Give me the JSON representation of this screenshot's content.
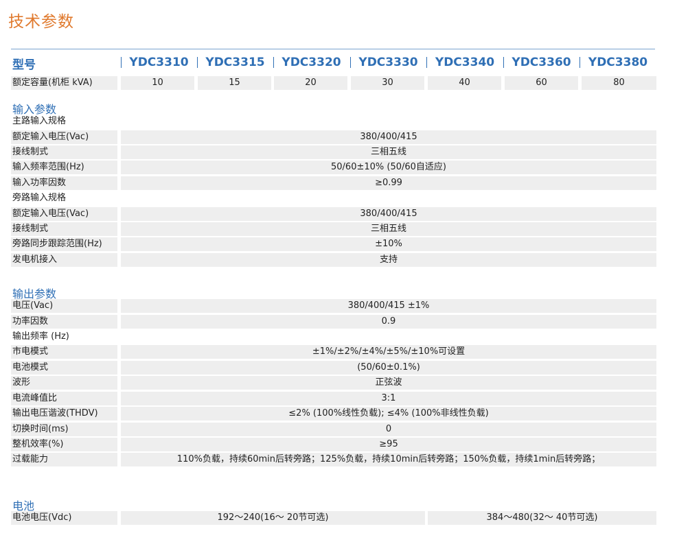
{
  "title": "技术参数",
  "model_header": {
    "label": "型号",
    "models": [
      "YDC3310",
      "YDC3315",
      "YDC3320",
      "YDC3330",
      "YDC3340",
      "YDC3360",
      "YDC3380"
    ]
  },
  "capacity": {
    "label": "额定容量(机柜 kVA)",
    "values": [
      "10",
      "15",
      "20",
      "30",
      "40",
      "60",
      "80"
    ]
  },
  "input": {
    "section_title": "输入参数",
    "main_spec": "主路输入规格",
    "main_rows": [
      {
        "label": "额定输入电压(Vac)",
        "value": "380/400/415"
      },
      {
        "label": "接线制式",
        "value": "三相五线"
      },
      {
        "label": "输入频率范围(Hz)",
        "value": "50/60±10% (50/60自适应)"
      },
      {
        "label": "输入功率因数",
        "value": "≥0.99"
      }
    ],
    "bypass_spec": "旁路输入规格",
    "bypass_rows": [
      {
        "label": "额定输入电压(Vac)",
        "value": "380/400/415"
      },
      {
        "label": "接线制式",
        "value": "三相五线"
      },
      {
        "label": "旁路同步跟踪范围(Hz)",
        "value": "±10%"
      },
      {
        "label": "发电机接入",
        "value": "支持"
      }
    ]
  },
  "output": {
    "section_title": "输出参数",
    "rows_a": [
      {
        "label": "电压(Vac)",
        "value": "380/400/415 ±1%"
      },
      {
        "label": "功率因数",
        "value": "0.9"
      }
    ],
    "freq_label": "输出频率 (Hz)",
    "rows_b": [
      {
        "label": "市电模式",
        "value": "±1%/±2%/±4%/±5%/±10%可设置"
      },
      {
        "label": "电池模式",
        "value": "(50/60±0.1%)"
      },
      {
        "label": "波形",
        "value": "正弦波"
      },
      {
        "label": "电流峰值比",
        "value": "3:1"
      },
      {
        "label": "输出电压谐波(THDV)",
        "value": "≤2% (100%线性负载); ≤4% (100%非线性负载)"
      },
      {
        "label": "切换时间(ms)",
        "value": "0"
      },
      {
        "label": "整机效率(%)",
        "value": "≥95"
      },
      {
        "label": "过载能力",
        "value": "110%负载，持续60min后转旁路；125%负载，持续10min后转旁路；150%负载，持续1min后转旁路；"
      }
    ]
  },
  "battery": {
    "section_title": "电池",
    "label": "电池电压(Vdc)",
    "value_a": "192～240(16～ 20节可选)",
    "value_b": "384～480(32～ 40节可选)"
  }
}
